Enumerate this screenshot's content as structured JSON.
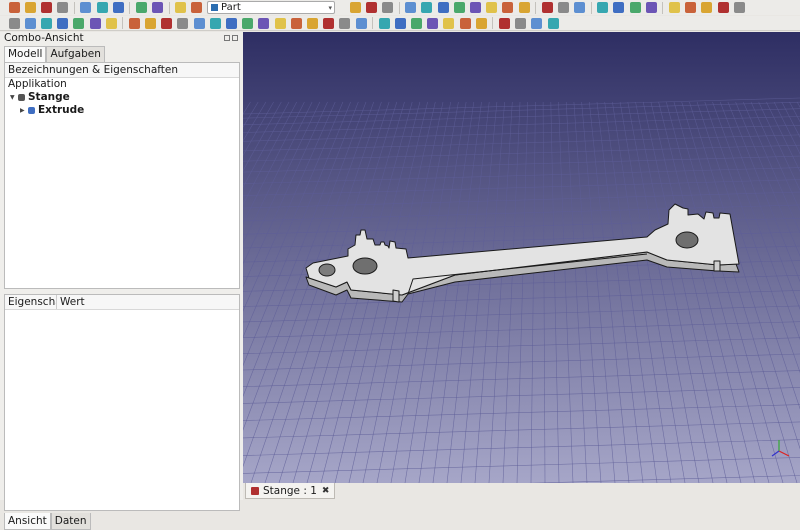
{
  "toolbar": {
    "workbench_selector": "Part",
    "row1_icons": [
      "new-file-icon",
      "open-file-icon",
      "save-icon",
      "print-icon",
      "cut-icon",
      "copy-icon",
      "paste-icon",
      "undo-icon",
      "redo-icon",
      "refresh-icon",
      "whats-this-icon",
      "fit-all-icon",
      "zoom-selection-icon",
      "draw-style-icon",
      "sync-view-icon",
      "view-iso-icon",
      "view-front-icon",
      "view-top-icon",
      "view-right-icon",
      "view-rear-icon",
      "view-bottom-icon",
      "view-left-icon",
      "measure-distance-icon",
      "std-part-icon",
      "std-group-icon",
      "record-macro-icon",
      "stop-macro-icon",
      "edit-macro-icon",
      "run-macro-icon",
      "zoom-in-icon",
      "zoom-out-icon",
      "selection-filter-icon",
      "clipping-icon",
      "snapshot-icon"
    ],
    "row2_icons": [
      "part-box-icon",
      "part-cylinder-icon",
      "part-sphere-icon",
      "part-cone-icon",
      "part-torus-icon",
      "part-tube-icon",
      "part-primitives-icon",
      "part-shape-builder-icon",
      "part-extrude-icon",
      "part-revolve-icon",
      "part-mirror-icon",
      "part-fillet-icon",
      "part-chamfer-icon",
      "part-make-face-icon",
      "part-ruled-surface-icon",
      "part-loft-icon",
      "part-sweep-icon",
      "part-section-icon",
      "part-cross-sections-icon",
      "part-offset-icon",
      "part-thickness-icon",
      "part-projection-icon",
      "part-boolean-icon",
      "part-cut-icon",
      "part-fuse-icon",
      "part-common-icon",
      "part-join-icon",
      "part-split-icon",
      "part-compound-icon",
      "part-check-geometry-icon",
      "part-defeaturing-icon",
      "part-measure-icon",
      "part-attachment-icon"
    ]
  },
  "left_panel": {
    "title": "Combo-Ansicht",
    "tabs": [
      "Modell",
      "Aufgaben"
    ],
    "tree": {
      "header": "Bezeichnungen & Eigenschaften",
      "section": "Applikation",
      "items": [
        {
          "label": "Stange",
          "icon": "document-icon",
          "expanded": true
        },
        {
          "label": "Extrude",
          "icon": "part-extrude-icon",
          "expanded": false
        }
      ]
    },
    "properties": {
      "col_property": "Eigenscha",
      "col_value": "Wert"
    },
    "bottom_tabs": [
      "Ansicht",
      "Daten"
    ]
  },
  "viewport": {
    "background_top": "#2e2e63",
    "background_bottom": "#a6a6c8",
    "grid_color": "#5e5e98",
    "part_face_color": "#e3e3e3",
    "part_side_color": "#b9b9b9",
    "edge_color": "#1a1a1a"
  },
  "document_tab": {
    "label": "Stange : 1",
    "close": "✖"
  }
}
